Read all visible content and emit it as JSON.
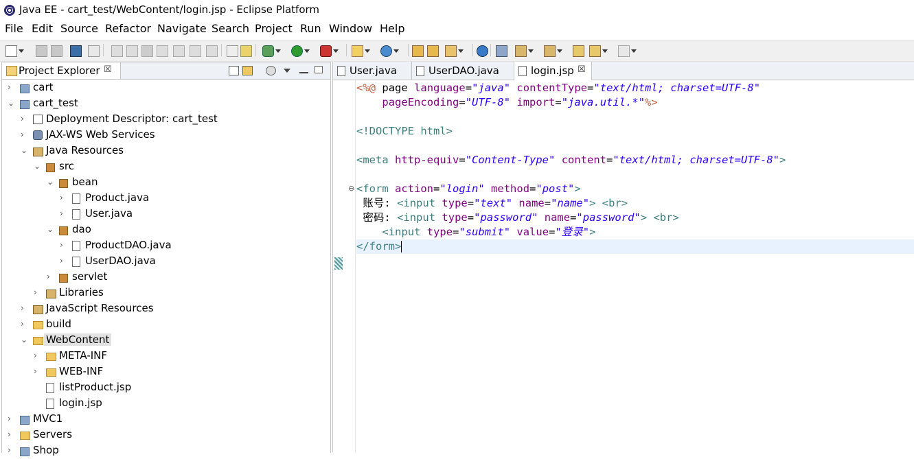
{
  "window": {
    "title": "Java EE - cart_test/WebContent/login.jsp - Eclipse Platform"
  },
  "menu": [
    "File",
    "Edit",
    "Source",
    "Refactor",
    "Navigate",
    "Search",
    "Project",
    "Run",
    "Window",
    "Help"
  ],
  "explorer": {
    "tab_label": "Project Explorer",
    "tab_close": "☒",
    "tree": [
      {
        "label": "cart",
        "depth": 0,
        "twisty": "›",
        "icon": "project-icon"
      },
      {
        "label": "cart_test",
        "depth": 0,
        "twisty": "⌄",
        "icon": "project-icon"
      },
      {
        "label": "Deployment Descriptor: cart_test",
        "depth": 1,
        "twisty": "›",
        "icon": "deployment-descriptor-icon"
      },
      {
        "label": "JAX-WS Web Services",
        "depth": 1,
        "twisty": "›",
        "icon": "web-services-icon"
      },
      {
        "label": "Java Resources",
        "depth": 1,
        "twisty": "⌄",
        "icon": "java-resources-icon"
      },
      {
        "label": "src",
        "depth": 2,
        "twisty": "⌄",
        "icon": "source-folder-icon"
      },
      {
        "label": "bean",
        "depth": 3,
        "twisty": "⌄",
        "icon": "package-icon"
      },
      {
        "label": "Product.java",
        "depth": 4,
        "twisty": "›",
        "icon": "java-file-icon"
      },
      {
        "label": "User.java",
        "depth": 4,
        "twisty": "›",
        "icon": "java-file-icon"
      },
      {
        "label": "dao",
        "depth": 3,
        "twisty": "⌄",
        "icon": "package-icon"
      },
      {
        "label": "ProductDAO.java",
        "depth": 4,
        "twisty": "›",
        "icon": "java-file-icon"
      },
      {
        "label": "UserDAO.java",
        "depth": 4,
        "twisty": "›",
        "icon": "java-file-icon"
      },
      {
        "label": "servlet",
        "depth": 3,
        "twisty": "›",
        "icon": "package-icon"
      },
      {
        "label": "Libraries",
        "depth": 2,
        "twisty": "›",
        "icon": "libraries-icon"
      },
      {
        "label": "JavaScript Resources",
        "depth": 1,
        "twisty": "›",
        "icon": "javascript-resources-icon"
      },
      {
        "label": "build",
        "depth": 1,
        "twisty": "›",
        "icon": "folder-icon"
      },
      {
        "label": "WebContent",
        "depth": 1,
        "twisty": "⌄",
        "icon": "folder-icon",
        "selected": true
      },
      {
        "label": "META-INF",
        "depth": 2,
        "twisty": "›",
        "icon": "folder-icon"
      },
      {
        "label": "WEB-INF",
        "depth": 2,
        "twisty": "›",
        "icon": "folder-icon"
      },
      {
        "label": "listProduct.jsp",
        "depth": 2,
        "twisty": "",
        "icon": "jsp-file-icon"
      },
      {
        "label": "login.jsp",
        "depth": 2,
        "twisty": "",
        "icon": "jsp-file-icon"
      },
      {
        "label": "MVC1",
        "depth": 0,
        "twisty": "›",
        "icon": "project-icon"
      },
      {
        "label": "Servers",
        "depth": 0,
        "twisty": "›",
        "icon": "folder-icon"
      },
      {
        "label": "Shop",
        "depth": 0,
        "twisty": "›",
        "icon": "project-icon"
      }
    ]
  },
  "editor": {
    "tabs": [
      {
        "label": "User.java",
        "active": false
      },
      {
        "label": "UserDAO.java",
        "active": false
      },
      {
        "label": "login.jsp",
        "active": true,
        "close": "☒"
      }
    ],
    "lines": [
      "<%@ page language=\"java\" contentType=\"text/html; charset=UTF-8\"",
      "    pageEncoding=\"UTF-8\" import=\"java.util.*\"%>",
      "",
      "<!DOCTYPE html>",
      "",
      "<meta http-equiv=\"Content-Type\" content=\"text/html; charset=UTF-8\">",
      "",
      "<form action=\"login\" method=\"post\">",
      " 账号: <input type=\"text\" name=\"name\"> <br>",
      " 密码: <input type=\"password\" name=\"password\"> <br>",
      "    <input type=\"submit\" value=\"登录\">",
      "</form>"
    ]
  }
}
